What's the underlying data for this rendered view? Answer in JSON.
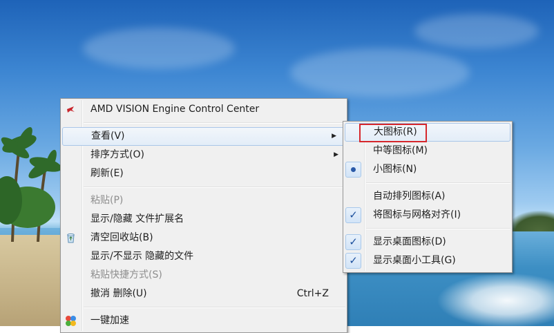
{
  "main_menu": {
    "items": [
      {
        "label": "AMD VISION Engine Control Center",
        "icon": "amd-icon"
      },
      {
        "label": "查看(V)",
        "submenu": true
      },
      {
        "label": "排序方式(O)",
        "submenu": true
      },
      {
        "label": "刷新(E)"
      },
      {
        "label": "粘贴(P)",
        "disabled": true
      },
      {
        "label": "显示/隐藏 文件扩展名"
      },
      {
        "label": "清空回收站(B)",
        "icon": "recycle-bin-icon"
      },
      {
        "label": "显示/不显示 隐藏的文件"
      },
      {
        "label": "粘贴快捷方式(S)",
        "disabled": true
      },
      {
        "label": "撤消 删除(U)",
        "shortcut": "Ctrl+Z"
      },
      {
        "label": "一键加速",
        "icon": "speedup-icon"
      }
    ]
  },
  "view_submenu": {
    "items": [
      {
        "label": "大图标(R)",
        "highlighted_box": true
      },
      {
        "label": "中等图标(M)"
      },
      {
        "label": "小图标(N)",
        "selected": true
      },
      {
        "label": "自动排列图标(A)"
      },
      {
        "label": "将图标与网格对齐(I)",
        "checked": true
      },
      {
        "label": "显示桌面图标(D)",
        "checked": true
      },
      {
        "label": "显示桌面小工具(G)",
        "checked": true
      }
    ],
    "check_glyph": "✓"
  },
  "colors": {
    "highlight_border": "#a9c6e8",
    "annotation_box": "#d6262b"
  }
}
